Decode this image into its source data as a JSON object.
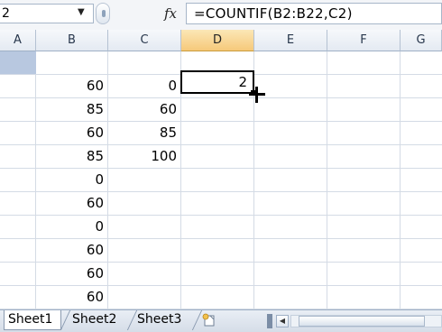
{
  "formula_bar": {
    "name_box": "2",
    "fx": "fx",
    "formula": "=COUNTIF(B2:B22,C2)"
  },
  "columns": [
    {
      "label": "A"
    },
    {
      "label": "B"
    },
    {
      "label": "C"
    },
    {
      "label": "D"
    },
    {
      "label": "E"
    },
    {
      "label": "F"
    },
    {
      "label": "G"
    }
  ],
  "rows": [
    {
      "b": "",
      "c": "",
      "d": ""
    },
    {
      "b": "60",
      "c": "0",
      "d": "2"
    },
    {
      "b": "85",
      "c": "60",
      "d": ""
    },
    {
      "b": "60",
      "c": "85",
      "d": ""
    },
    {
      "b": "85",
      "c": "100",
      "d": ""
    },
    {
      "b": "0",
      "c": "",
      "d": ""
    },
    {
      "b": "60",
      "c": "",
      "d": ""
    },
    {
      "b": "0",
      "c": "",
      "d": ""
    },
    {
      "b": "60",
      "c": "",
      "d": ""
    },
    {
      "b": "60",
      "c": "",
      "d": ""
    },
    {
      "b": "60",
      "c": "",
      "d": ""
    },
    {
      "b": "60",
      "c": "",
      "d": ""
    }
  ],
  "active_cell": {
    "value": "2"
  },
  "sheet_tabs": [
    {
      "label": "Sheet1"
    },
    {
      "label": "Sheet2"
    },
    {
      "label": "Sheet3"
    }
  ],
  "colors": {
    "selected_header": "#f6c97a",
    "grid_line": "#d4dbe5",
    "header_band": "#b8c8e0"
  }
}
